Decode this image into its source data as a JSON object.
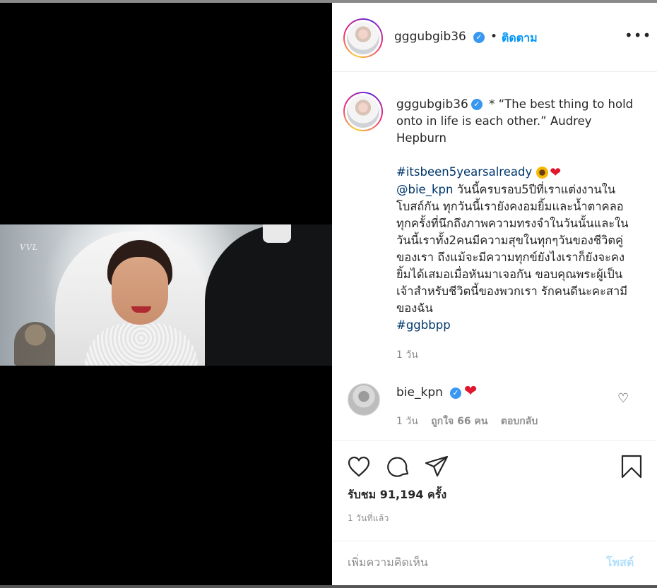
{
  "header": {
    "username": "gggubgib36",
    "dot": "•",
    "follow_label": "ติดตาม",
    "more_label": "•••"
  },
  "media": {
    "watermark": "VVL"
  },
  "caption": {
    "username": "gggubgib36",
    "lines": [
      "* “The best thing to hold onto in life is each other.” Audrey Hepburn"
    ],
    "hashtag1": "#itsbeen5yearsalready",
    "mention": "@bie_kpn",
    "body": "วันนี้ครบรอบ5ปีที่เราแต่งงานในโบสถ์กัน ทุกวันนี้เรายังคงอมยิ้มและน้ำตาคลอทุกครั้งที่นึกถึงภาพความทรงจำในวันนั้นและในวันนี้เราทั้ง2คนมีความสุขในทุกๆวันของชีวิตคู่ของเรา ถึงแม้จะมีความทุกข์ยังไงเราก็ยังจะคงยิ้มได้เสมอเมื่อหันมาเจอกัน ขอบคุณพระผู้เป็นเจ้าสำหรับชีวิตนี้ของพวกเรา รักคนดีนะคะสามีของฉัน",
    "hashtag2": "#ggbbpp",
    "time": "1 วัน"
  },
  "comment": {
    "username": "bie_kpn",
    "time": "1 วัน",
    "likes": "ถูกใจ 66 คน",
    "reply": "ตอบกลับ"
  },
  "footer": {
    "views": "รับชม 91,194 ครั้ง",
    "time_ago": "1 วันที่แล้ว",
    "add_comment_placeholder": "เพิ่มความคิดเห็น",
    "post_label": "โพสต์"
  },
  "colors": {
    "link_blue": "#0095f6",
    "hashtag": "#00376b",
    "verified": "#3897f0",
    "heart": "#e0182d",
    "muted": "#8e8e8e"
  },
  "icons": [
    "verified-icon",
    "heart-icon",
    "comment-icon",
    "share-icon",
    "bookmark-icon",
    "more-icon"
  ]
}
